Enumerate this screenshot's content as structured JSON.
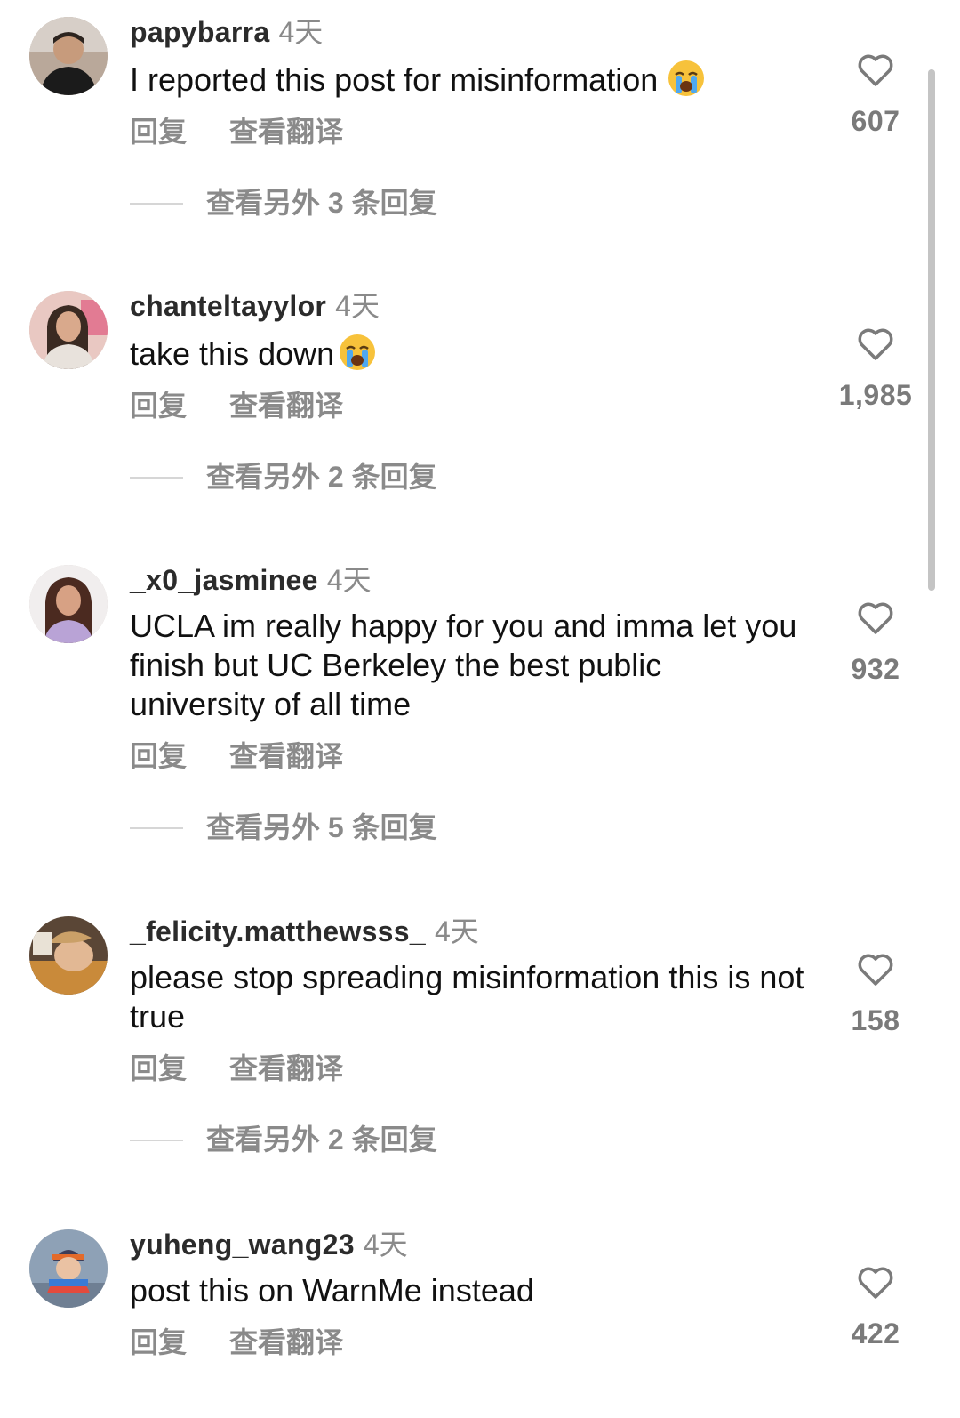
{
  "comments": [
    {
      "username": "papybarra",
      "time": "4天",
      "text": "I reported this post for misinformation",
      "emoji": "loudly-crying-face",
      "reply_label": "回复",
      "translate_label": "查看翻译",
      "view_replies": "查看另外 3 条回复",
      "likes": "607"
    },
    {
      "username": "chanteltayylor",
      "time": "4天",
      "text": "take this down",
      "emoji": "loudly-crying-face",
      "reply_label": "回复",
      "translate_label": "查看翻译",
      "view_replies": "查看另外 2 条回复",
      "likes": "1,985"
    },
    {
      "username": "_x0_jasminee",
      "time": "4天",
      "text": "UCLA im really happy for you and imma let you finish but UC Berkeley the best public university of all time",
      "reply_label": "回复",
      "translate_label": "查看翻译",
      "view_replies": "查看另外 5 条回复",
      "likes": "932"
    },
    {
      "username": "_felicity.matthewsss_",
      "time": "4天",
      "text": "please stop spreading misinformation this is not true",
      "reply_label": "回复",
      "translate_label": "查看翻译",
      "view_replies": "查看另外 2 条回复",
      "likes": "158"
    },
    {
      "username": "yuheng_wang23",
      "time": "4天",
      "text": "post this on WarnMe instead",
      "reply_label": "回复",
      "translate_label": "查看翻译",
      "likes": "422"
    }
  ],
  "icons": {
    "like": "heart-outline-icon",
    "emoji": "loudly-crying-face-emoji"
  },
  "colors": {
    "username": "#2b2b2b",
    "secondary_text": "#8a8a8a",
    "body_text": "#111111",
    "divider": "#d6d6d6"
  }
}
